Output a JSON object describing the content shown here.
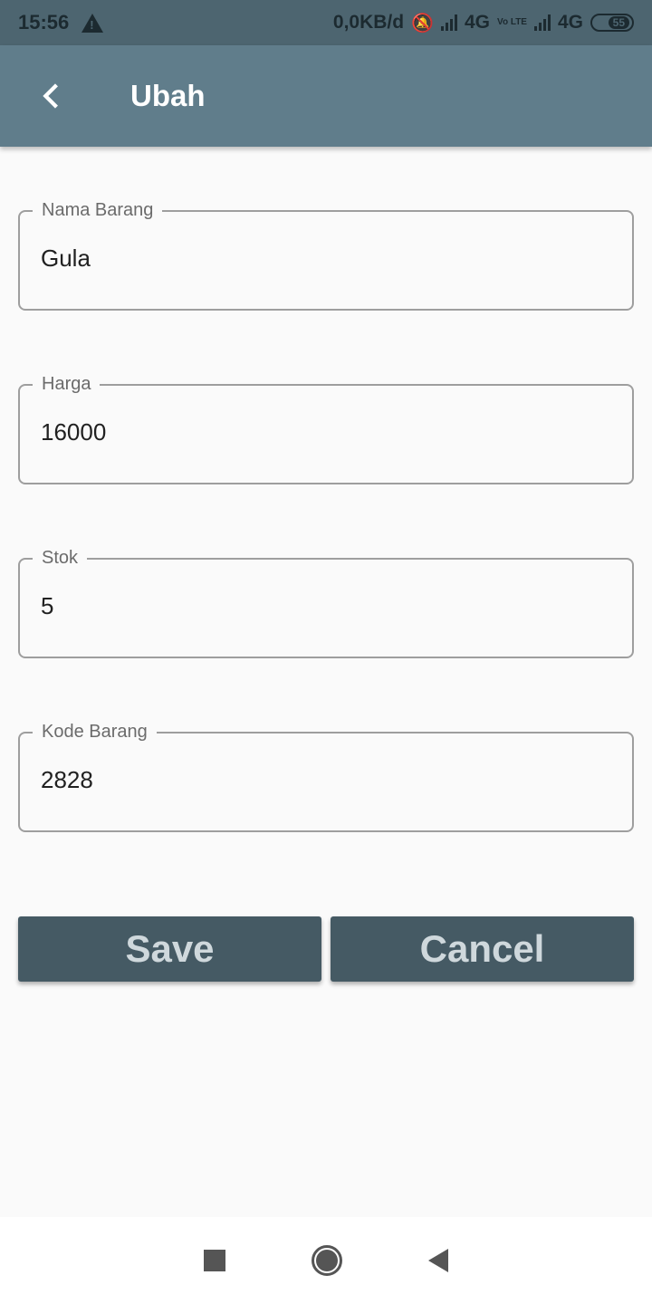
{
  "status_bar": {
    "time": "15:56",
    "network_speed": "0,0KB/d",
    "sim1_type": "4G",
    "volte": "Vo LTE",
    "sim2_type": "4G",
    "battery": "55",
    "icons": [
      "warning-icon",
      "bell-off-icon",
      "signal-icon",
      "signal-icon",
      "battery-icon"
    ]
  },
  "app_bar": {
    "title": "Ubah",
    "back_icon": "chevron-left-icon",
    "color": "#607d8b"
  },
  "form": {
    "fields": [
      {
        "label": "Nama Barang",
        "value": "Gula"
      },
      {
        "label": "Harga",
        "value": "16000"
      },
      {
        "label": "Stok",
        "value": "5"
      },
      {
        "label": "Kode Barang",
        "value": "2828"
      }
    ]
  },
  "actions": {
    "save_label": "Save",
    "cancel_label": "Cancel",
    "button_color": "#455a64"
  },
  "nav_bar": {
    "icons": [
      "recents-square-icon",
      "home-circle-icon",
      "back-triangle-icon"
    ]
  }
}
